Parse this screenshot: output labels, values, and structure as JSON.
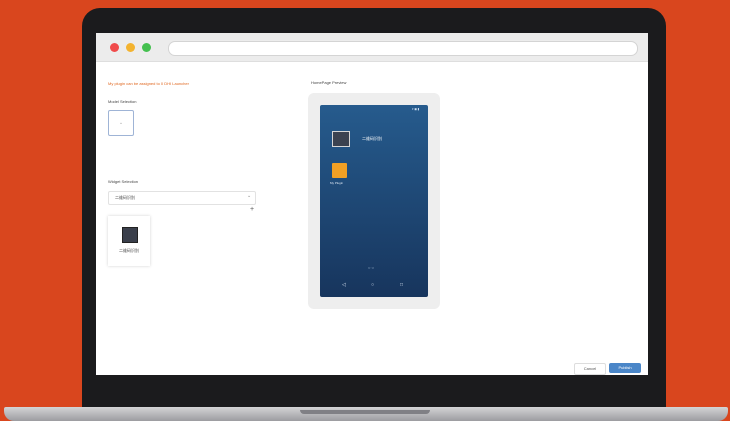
{
  "colors": {
    "background": "#d9461e",
    "accent": "#e0671f",
    "primary_button": "#4a86c8",
    "phone_gradient_top": "#265b8d",
    "phone_gradient_bottom": "#17355d",
    "app_icon": "#f2a024"
  },
  "form": {
    "notice": "My plugin can be assigned to 0 DHI Launcher",
    "model_label": "Model Selection",
    "model_select_text": "+",
    "widget_label": "Widget Selection",
    "widget_select_value": "二维码识别",
    "widget_add_icon": "+",
    "widget_card_caption": "二维码识别",
    "widget_card_icon": "qr-widget-icon"
  },
  "preview": {
    "label": "HomePage Preview",
    "status_bar": "▾ ◼ ▮",
    "widget_title": "二维码识别",
    "app_caption": "My Plugin",
    "pager": "○ ○",
    "nav_back": "◁",
    "nav_home": "○",
    "nav_recent": "□"
  },
  "actions": {
    "cancel_label": "Cancel",
    "publish_label": "Publish"
  }
}
